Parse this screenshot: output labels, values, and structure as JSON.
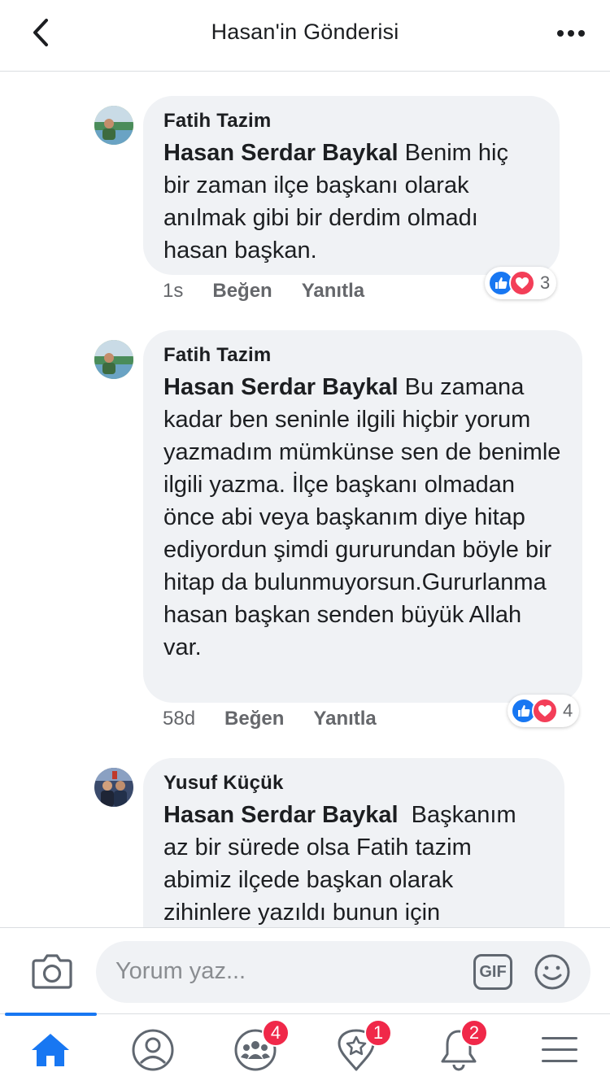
{
  "header": {
    "title": "Hasan'in Gönderisi",
    "back_icon": "chevron-left-icon",
    "more_icon": "more-dots-icon"
  },
  "comments": [
    {
      "author": "Fatih Tazim",
      "mention": "Hasan Serdar Baykal",
      "text": " Benim hiç bir zaman ilçe başkanı olarak anılmak gibi bir derdim olmadı hasan başkan.",
      "time": "1s",
      "like_label": "Beğen",
      "reply_label": "Yanıtla",
      "reaction_count": "3"
    },
    {
      "author": "Fatih Tazim",
      "mention": "Hasan Serdar Baykal",
      "text": " Bu zamana kadar ben seninle ilgili hiçbir yorum yazmadım mümkünse sen de benimle ilgili yazma. İlçe başkanı olmadan önce abi veya başkanım diye hitap ediyordun şimdi gururundan böyle bir hitap da bulunmuyorsun.Gururlanma hasan başkan senden büyük Allah var.",
      "time": "58d",
      "like_label": "Beğen",
      "reply_label": "Yanıtla",
      "reaction_count": "4"
    },
    {
      "author": "Yusuf Küçük",
      "mention": "Hasan Serdar Baykal",
      "text": "  Başkanım az bir sürede olsa Fatih tazim abimiz ilçede başkan olarak zihinlere yazıldı bunun için"
    }
  ],
  "composer": {
    "placeholder": "Yorum yaz...",
    "gif_label": "GIF",
    "camera_icon": "camera-icon",
    "emoji_icon": "smiley-icon"
  },
  "tabbar": {
    "tabs": [
      {
        "icon": "home-icon",
        "active": true,
        "badge": ""
      },
      {
        "icon": "profile-icon",
        "active": false,
        "badge": ""
      },
      {
        "icon": "groups-icon",
        "active": false,
        "badge": "4"
      },
      {
        "icon": "favorites-icon",
        "active": false,
        "badge": "1"
      },
      {
        "icon": "bell-icon",
        "active": false,
        "badge": "2"
      },
      {
        "icon": "menu-icon",
        "active": false,
        "badge": ""
      }
    ]
  },
  "colors": {
    "accent": "#1877f2",
    "badge": "#f02849",
    "bubble": "#f0f2f5",
    "love": "#f33e58"
  }
}
